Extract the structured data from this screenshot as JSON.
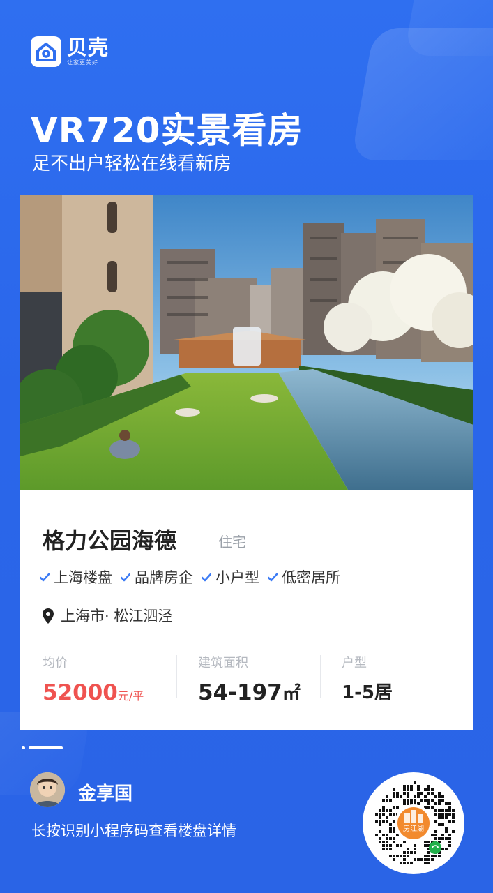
{
  "brand": {
    "name": "贝壳",
    "slogan": "让家更美好"
  },
  "header": {
    "title": "VR720实景看房",
    "subtitle": "足不出户轻松在线看新房"
  },
  "project": {
    "name": "格力公园海德",
    "type": "住宅",
    "tags": [
      "上海楼盘",
      "品牌房企",
      "小户型",
      "低密居所"
    ],
    "location": "上海市· 松江泗泾"
  },
  "stats": {
    "price": {
      "label": "均价",
      "value": "52000",
      "unit": "元/平"
    },
    "area": {
      "label": "建筑面积",
      "value": "54-197",
      "unit": "㎡"
    },
    "layout": {
      "label": "户型",
      "value": "1-5居"
    }
  },
  "agent": {
    "name": "金享国"
  },
  "footer": {
    "hint": "长按识别小程序码查看楼盘详情"
  },
  "qr": {
    "center_label": "房江湖"
  },
  "colors": {
    "background": "#2f6ff0",
    "price": "#ef5350",
    "check": "#3d7cf5"
  }
}
